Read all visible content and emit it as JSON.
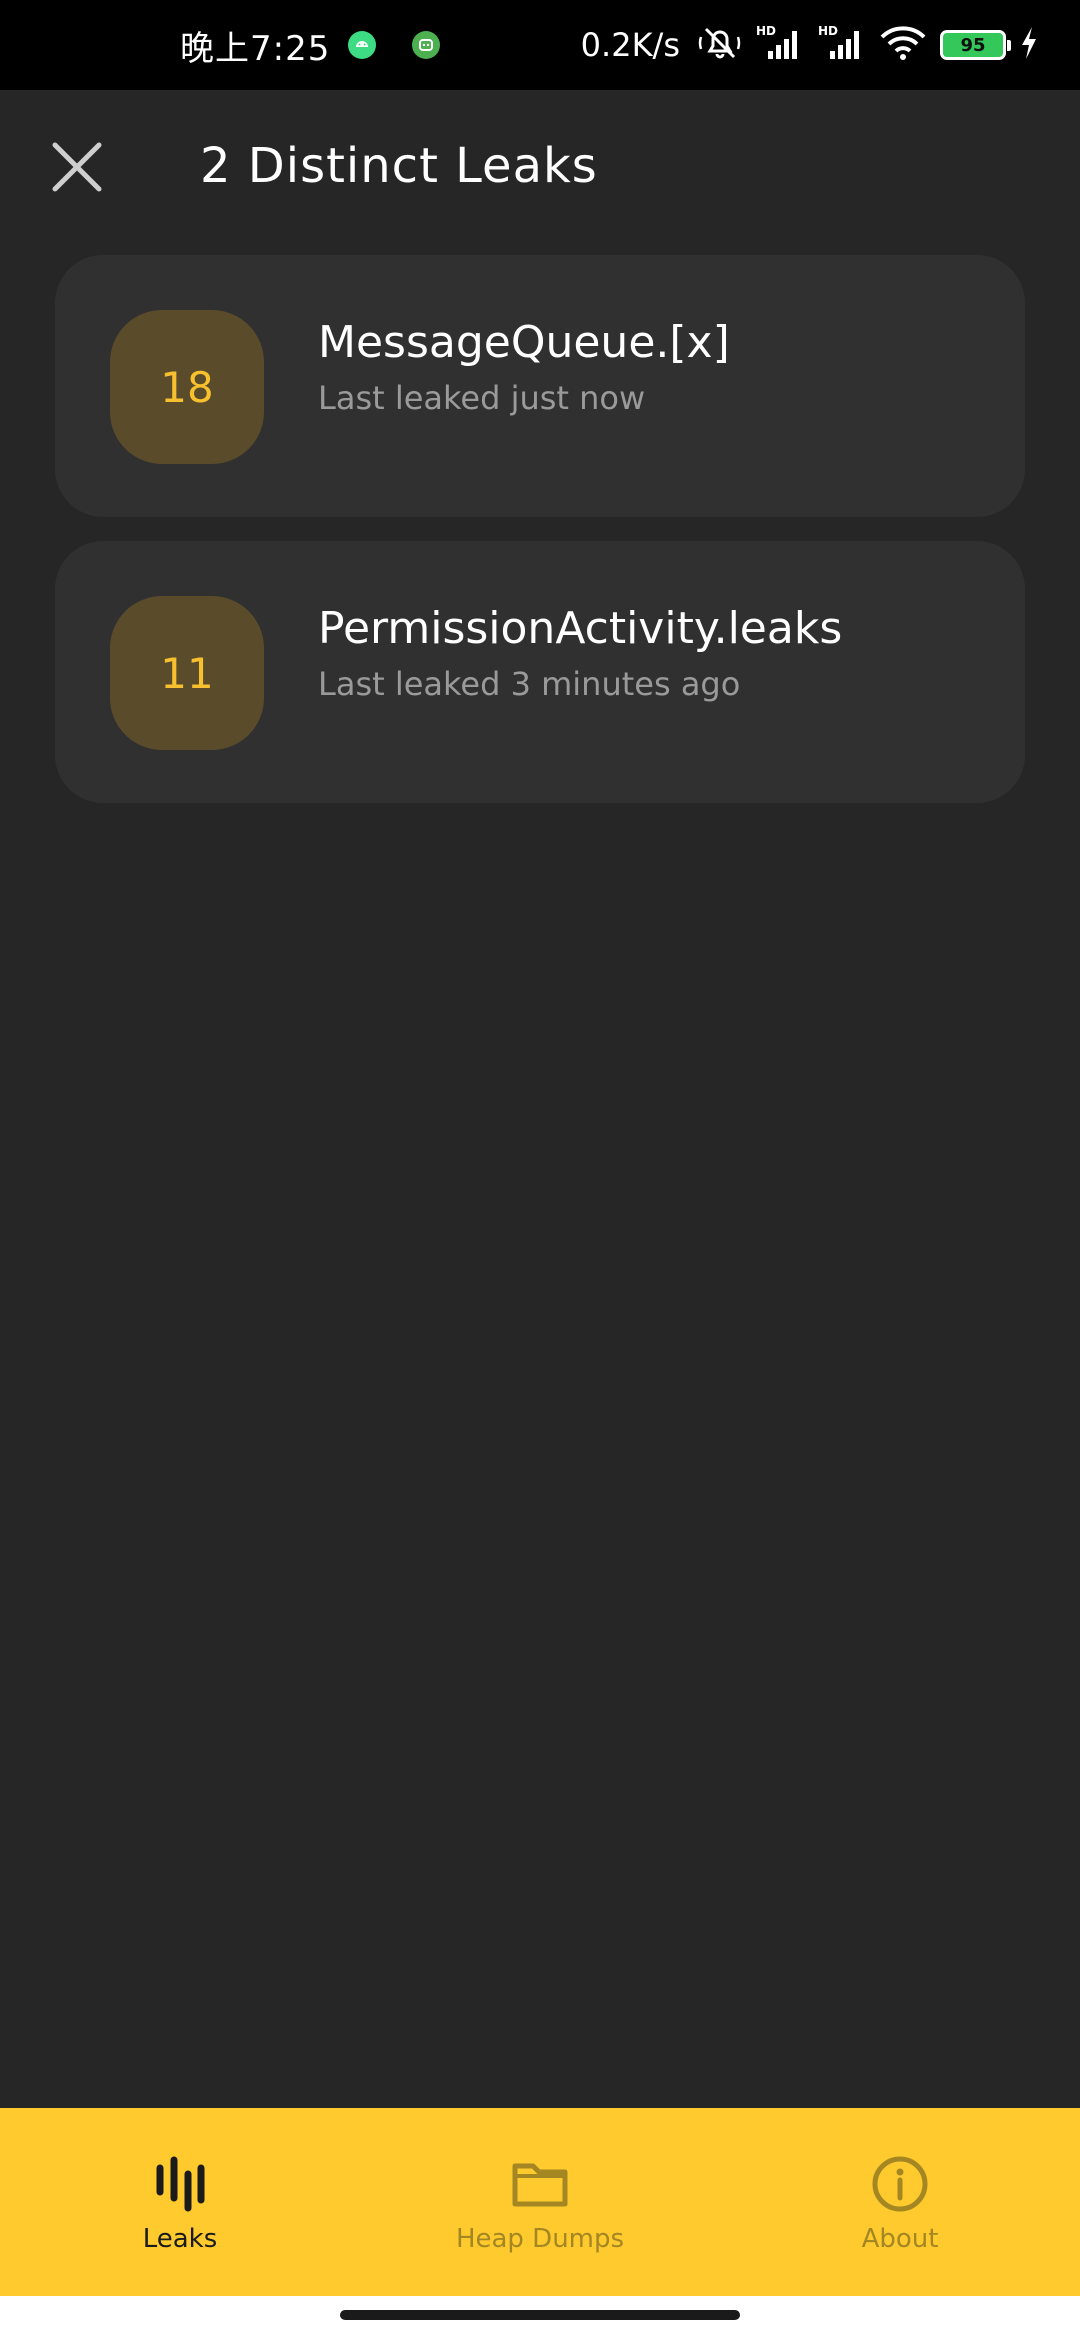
{
  "status_bar": {
    "time": "晚上7:25",
    "net_speed": "0.2K/s",
    "battery": "95",
    "icons": [
      "android-icon",
      "app-icon",
      "mute-icon",
      "hd-signal-icon",
      "hd-signal-icon",
      "wifi-icon",
      "battery-icon",
      "charging-icon"
    ]
  },
  "app_bar": {
    "title": "2 Distinct Leaks",
    "close_icon": "close-icon"
  },
  "leaks": [
    {
      "count": "18",
      "title": "MessageQueue.[x]",
      "subtitle": "Last leaked just now"
    },
    {
      "count": "11",
      "title": "PermissionActivity.leaks",
      "subtitle": "Last leaked 3 minutes ago"
    }
  ],
  "bottom_nav": {
    "items": [
      {
        "label": "Leaks",
        "icon": "leaks-icon",
        "active": true
      },
      {
        "label": "Heap Dumps",
        "icon": "folder-icon",
        "active": false
      },
      {
        "label": "About",
        "icon": "info-icon",
        "active": false
      }
    ]
  },
  "colors": {
    "background": "#262626",
    "card": "#303030",
    "badge": "#5a4b2b",
    "accent": "#ffca2e",
    "count_text": "#f6c02f"
  }
}
